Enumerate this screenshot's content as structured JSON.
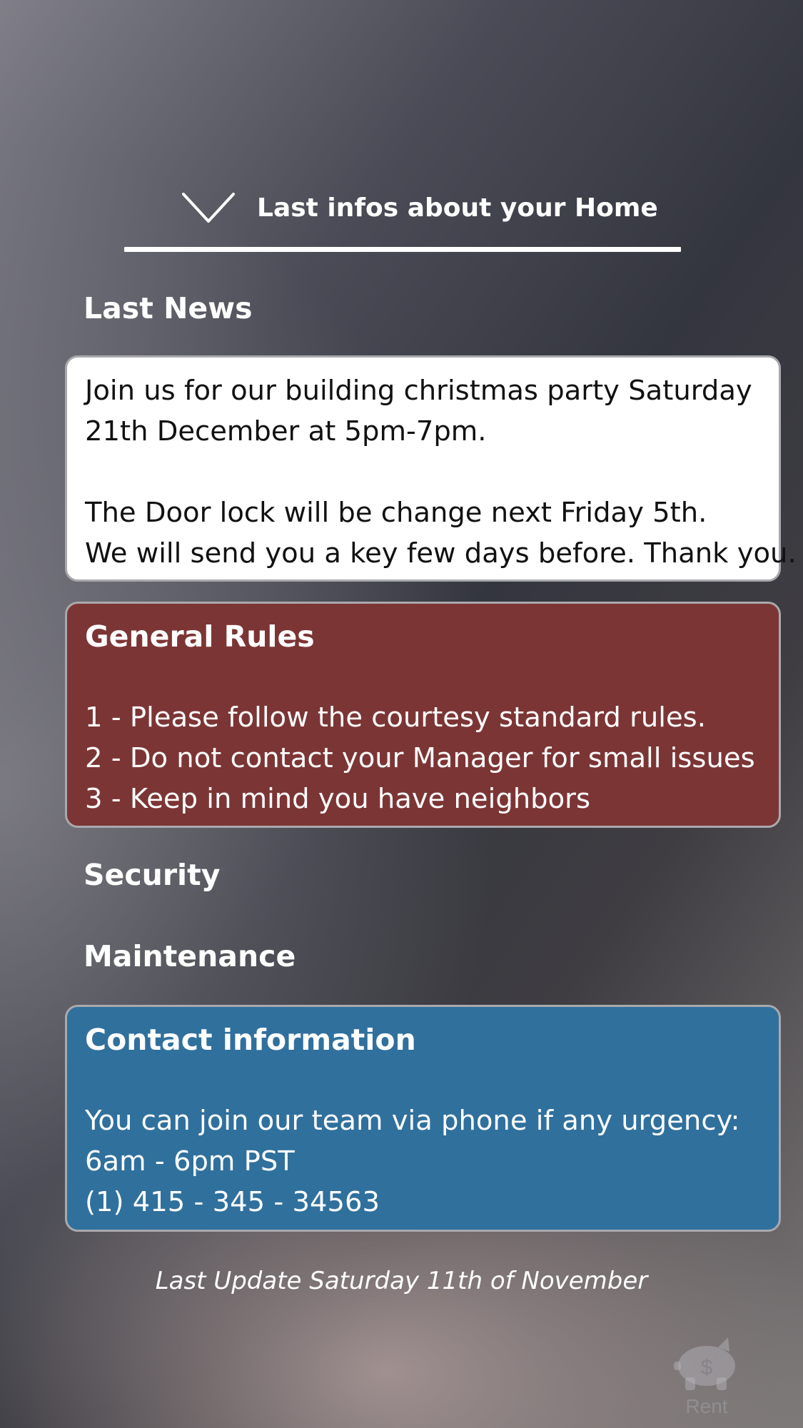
{
  "header": {
    "collapse_icon": "chevron-down-icon",
    "title": "Last infos about your Home"
  },
  "sections": {
    "last_news": {
      "heading": "Last News",
      "lines": [
        "Join us for our building christmas party Saturday",
        "21th December at 5pm-7pm.",
        "",
        "The Door lock will be change next Friday 5th.",
        "We will send you a key few days before. Thank you."
      ]
    },
    "general_rules": {
      "heading": "General Rules",
      "lines": [
        "1 - Please follow the courtesy standard rules.",
        "2 - Do not contact your Manager for small issues",
        "3 - Keep in mind you have neighbors"
      ]
    },
    "security": {
      "heading": "Security"
    },
    "maintenance": {
      "heading": "Maintenance"
    },
    "contact": {
      "heading": "Contact information",
      "lines": [
        "You can join our team via phone if any urgency:",
        "6am - 6pm PST",
        "(1) 415 - 345 - 34563"
      ]
    }
  },
  "footer": {
    "last_update": "Last Update Saturday 11th of November"
  },
  "tab_bar": {
    "rent": {
      "icon": "piggy-bank-icon",
      "label": "Rent"
    }
  },
  "colors": {
    "news_card": "#ffffff",
    "rules_card": "#7c3535",
    "contact_card": "#30709d",
    "text_light": "#ffffff",
    "text_dark": "#111111"
  }
}
